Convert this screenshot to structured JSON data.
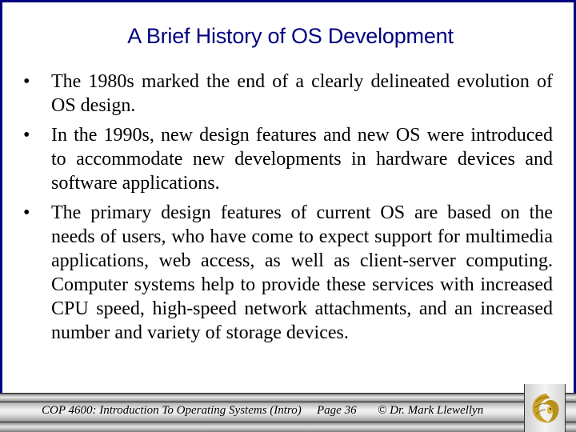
{
  "slide": {
    "title": "A Brief History of OS Development",
    "bullets": [
      {
        "marker": "•",
        "text": "The 1980s marked the end of a clearly delineated evolution of OS design."
      },
      {
        "marker": "•",
        "text": "In the 1990s, new design features and new OS were introduced to accommodate new developments in hardware devices and software applications."
      },
      {
        "marker": "•",
        "text": "The primary design features of current OS are based on the needs of users, who have come to expect support for multimedia applications, web access, as well as client-server computing.  Computer systems help to provide these services with increased CPU speed, high-speed network attachments, and an increased number and variety of storage devices."
      }
    ]
  },
  "footer": {
    "course": "COP 4600: Introduction To Operating Systems (Intro)",
    "page": "Page 36",
    "copyright": "© Dr. Mark Llewellyn",
    "logo_icon": "pegasus-logo-icon"
  },
  "colors": {
    "frame": "#000080",
    "title": "#000080",
    "logo_gold": "#C9A227"
  }
}
